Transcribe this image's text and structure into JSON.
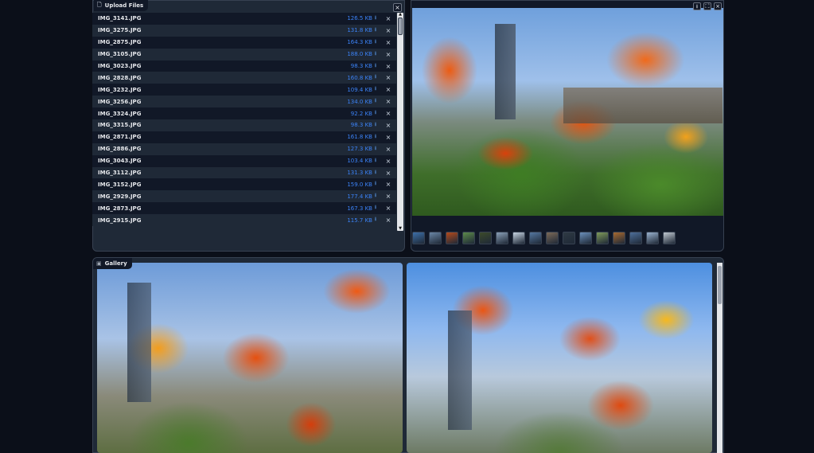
{
  "upload": {
    "label": "Upload Files",
    "label_icon": "file-icon",
    "close_glyph": "×",
    "row_remove_glyph": "×",
    "download_glyph": "⭳",
    "files": [
      {
        "name": "IMG_3141.JPG",
        "size": "126.5 KB"
      },
      {
        "name": "IMG_3275.JPG",
        "size": "131.8 KB"
      },
      {
        "name": "IMG_2875.JPG",
        "size": "164.3 KB"
      },
      {
        "name": "IMG_3105.JPG",
        "size": "188.0 KB"
      },
      {
        "name": "IMG_3023.JPG",
        "size": "98.3 KB"
      },
      {
        "name": "IMG_2828.JPG",
        "size": "160.8 KB"
      },
      {
        "name": "IMG_3232.JPG",
        "size": "109.4 KB"
      },
      {
        "name": "IMG_3256.JPG",
        "size": "134.0 KB"
      },
      {
        "name": "IMG_3324.JPG",
        "size": "92.2 KB"
      },
      {
        "name": "IMG_3315.JPG",
        "size": "98.3 KB"
      },
      {
        "name": "IMG_2871.JPG",
        "size": "161.8 KB"
      },
      {
        "name": "IMG_2886.JPG",
        "size": "127.3 KB"
      },
      {
        "name": "IMG_3043.JPG",
        "size": "103.4 KB"
      },
      {
        "name": "IMG_3112.JPG",
        "size": "131.3 KB"
      },
      {
        "name": "IMG_3152.JPG",
        "size": "159.0 KB"
      },
      {
        "name": "IMG_2929.JPG",
        "size": "177.4 KB"
      },
      {
        "name": "IMG_2873.JPG",
        "size": "167.3 KB"
      },
      {
        "name": "IMG_2915.JPG",
        "size": "115.7 KB"
      }
    ]
  },
  "preview": {
    "download_glyph": "⭳",
    "fullscreen_glyph": "⛶",
    "close_glyph": "×",
    "thumbnails": [
      "#3d6fa8",
      "#6a86a6",
      "#b44a1c",
      "#5d8a4a",
      "#3c4a2a",
      "#8aa0b8",
      "#c7d4e2",
      "#5577a0",
      "#7c6a58",
      "#2f3a44",
      "#6b8fba",
      "#7f9a5a",
      "#a86a30",
      "#4e6f9a",
      "#9ab2cf",
      "#c0c8d0"
    ]
  },
  "gallery": {
    "label": "Gallery",
    "label_icon": "image-icon"
  }
}
